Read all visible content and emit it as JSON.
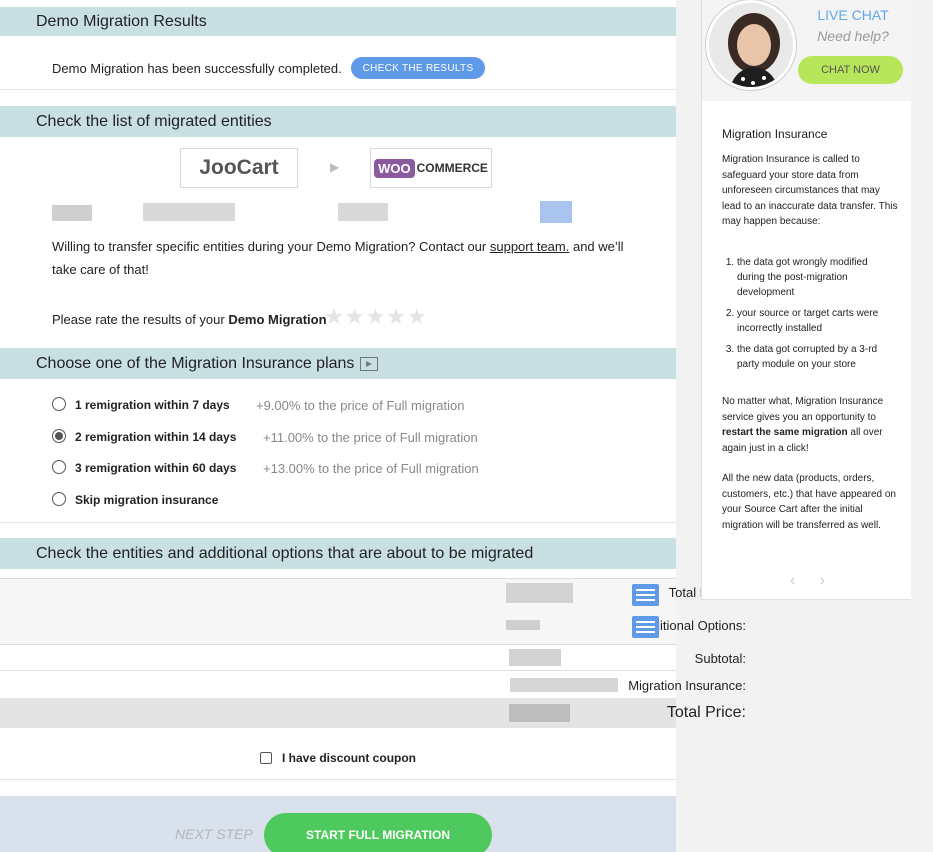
{
  "results": {
    "header": "Demo Migration Results",
    "message": "Demo Migration has been successfully completed.",
    "check_button": "CHECK THE RESULTS"
  },
  "entities": {
    "header": "Check the list of migrated entities",
    "source_logo": "JooCart",
    "target_logo_woo": "WOO",
    "target_logo_commerce": "COMMERCE",
    "transfer_text_1": "Willing to transfer specific entities during your Demo Migration? Contact our ",
    "support_link": "support team.",
    "transfer_text_2": " and we’ll",
    "transfer_text_3": "take care of that!",
    "rate_text": "Please rate the results of your ",
    "rate_bold": "Demo Migration",
    "stars": "★★★★★"
  },
  "insurance": {
    "header": "Choose one of the Migration Insurance plans",
    "header_icon": "video-icon",
    "options": [
      {
        "label": "1 remigration within 7 days",
        "price": "+9.00% to the price of Full migration",
        "selected": false
      },
      {
        "label": "2 remigration within 14 days",
        "price": "+11.00% to the price of Full migration",
        "selected": true
      },
      {
        "label": "3 remigration within 60 days",
        "price": "+13.00% to the price of Full migration",
        "selected": false
      },
      {
        "label": "Skip migration insurance",
        "price": "",
        "selected": false
      }
    ]
  },
  "summary": {
    "header": "Check the entities and additional options that are about to be migrated",
    "total_entities": "Total Entities:",
    "additional_options": "Additional Options:",
    "subtotal": "Subtotal:",
    "migration_insurance": "Migration Insurance:",
    "total_price": "Total Price:",
    "discount": "I have discount coupon"
  },
  "footer": {
    "next_step": "NEXT STEP",
    "start_button": "START FULL MIGRATION"
  },
  "sidebar": {
    "live_chat": "LIVE CHAT",
    "need_help": "Need help?",
    "chat_button": "CHAT NOW",
    "title": "Migration Insurance",
    "intro_1": "Migration Insurance is called to safeguard your store data from unforeseen circumstances that may lead to an inaccurate data transfer. This may happen because:",
    "reasons": [
      "the data got wrongly modified during the post-migration development",
      "your source or target carts were incorrectly installed",
      "the data got corrupted by a 3-rd party module on your store"
    ],
    "para2_a": "No matter what, Migration Insurance service gives you an opportunity to ",
    "para2_bold": "restart the same migration",
    "para2_b": " all over again just in a click!",
    "para3": "All the new data (products, orders, customers, etc.) that have appeared on your Source Cart after the initial migration will be transferred as well.",
    "arrows": "‹ ›"
  },
  "colors": {
    "header_bg": "#c9e0e3",
    "accent_blue": "#5f9ae8",
    "start_green": "#4ec95d",
    "chat_green": "#b8e65a",
    "live_chat_blue": "#5fa8e8"
  }
}
